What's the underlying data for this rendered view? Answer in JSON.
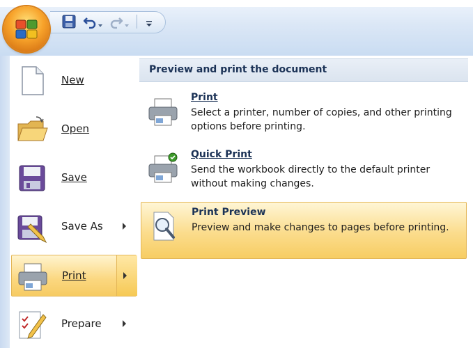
{
  "quick_access": {
    "save": "save-icon",
    "undo": "undo-icon",
    "redo": "redo-icon",
    "customize": "customize-qat-icon"
  },
  "left_menu": {
    "items": [
      {
        "label": "New",
        "icon": "new-document-icon"
      },
      {
        "label": "Open",
        "icon": "open-folder-icon"
      },
      {
        "label": "Save",
        "icon": "floppy-disk-icon"
      },
      {
        "label": "Save As",
        "icon": "save-as-icon",
        "has_submenu": true
      },
      {
        "label": "Print",
        "icon": "printer-icon",
        "has_submenu": true,
        "active": true
      },
      {
        "label": "Prepare",
        "icon": "prepare-icon",
        "has_submenu": true
      }
    ]
  },
  "submenu": {
    "header": "Preview and print the document",
    "items": [
      {
        "title": "Print",
        "description": "Select a printer, number of copies, and other printing options before printing.",
        "icon": "printer-icon"
      },
      {
        "title": "Quick Print",
        "description": "Send the workbook directly to the default printer without making changes.",
        "icon": "quick-print-icon"
      },
      {
        "title": "Print Preview",
        "description": "Preview and make changes to pages before printing.",
        "icon": "print-preview-icon",
        "highlighted": true
      }
    ]
  },
  "colors": {
    "highlight": "#fbd77f",
    "header_text": "#1b3256",
    "ribbon_blue": "#c9dcf2"
  }
}
